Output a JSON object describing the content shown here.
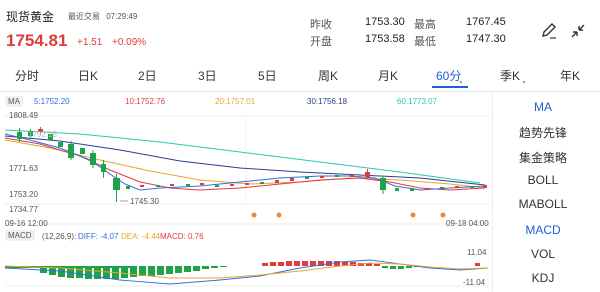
{
  "header": {
    "title": "现货黄金",
    "latest_label": "最近交易",
    "latest_time": "07:29:49",
    "price": "1754.81",
    "change": "+1.51",
    "change_pct": "+0.09%",
    "stats": {
      "prev_close_label": "昨收",
      "prev_close": "1753.30",
      "high_label": "最高",
      "high": "1767.45",
      "open_label": "开盘",
      "open": "1753.58",
      "low_label": "最低",
      "low": "1747.30"
    }
  },
  "tabs": [
    "分时",
    "日K",
    "2日",
    "3日",
    "5日",
    "周K",
    "月K",
    "60分",
    "季K",
    "年K"
  ],
  "active_tab": "60分",
  "ma": {
    "label": "MA",
    "values": [
      {
        "text": "5:1752.20",
        "color": "#2f6fe0"
      },
      {
        "text": "10:1752.76",
        "color": "#e23b3b"
      },
      {
        "text": "20:1757.01",
        "color": "#e8a531"
      },
      {
        "text": "30:1756.18",
        "color": "#2a3f8f"
      },
      {
        "text": "60:1773.07",
        "color": "#2bc7b4"
      }
    ]
  },
  "price_axis": {
    "top": "1808.49",
    "upper": "1792.15",
    "mid": "1771.63",
    "lower": "1753.20",
    "bottom": "1734.77"
  },
  "annotation": "1745.30",
  "time_axis": {
    "start": "09-16 12:00",
    "end": "09-18 04:00"
  },
  "macd": {
    "label": "MACD",
    "params": "(12,26,9):",
    "diff": "DIFF: -4.07",
    "dea": "DEA: -4.44",
    "macd": "MACD: 0.76",
    "axis_top": "11.04",
    "axis_bottom": "-11.04",
    "diff_color": "#2f6fe0",
    "dea_color": "#e8a531",
    "macd_color": "#e23b3b"
  },
  "side_panel": {
    "items": [
      "MA",
      "趋势先锋",
      "集金策略",
      "BOLL",
      "MABOLL",
      "MACD",
      "VOL",
      "KDJ"
    ],
    "active": [
      "MA",
      "MACD"
    ]
  },
  "colors": {
    "up": "#e23b3b",
    "down": "#1fa24a",
    "accent": "#1f5fd6"
  }
}
